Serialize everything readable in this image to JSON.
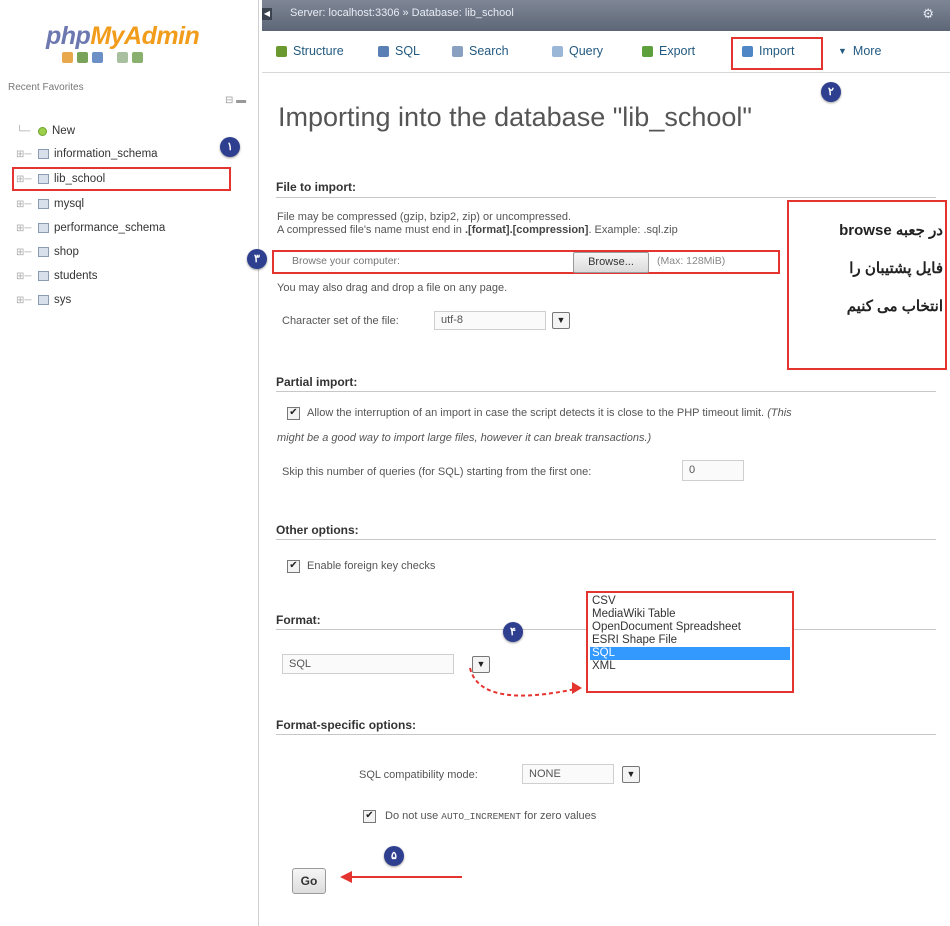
{
  "sidebar": {
    "logo_php": "php",
    "logo_myadmin": "MyAdmin",
    "recent_favorites": "Recent   Favorites",
    "databases": [
      {
        "label": "New"
      },
      {
        "label": "information_schema"
      },
      {
        "label": "lib_school"
      },
      {
        "label": "mysql"
      },
      {
        "label": "performance_schema"
      },
      {
        "label": "shop"
      },
      {
        "label": "students"
      },
      {
        "label": "sys"
      }
    ]
  },
  "topbar": {
    "breadcrumb": "Server: localhost:3306 » Database: lib_school"
  },
  "tabs": [
    {
      "label": "Structure",
      "icon": "structure-icon",
      "color": "#6a9a2f"
    },
    {
      "label": "SQL",
      "icon": "sql-icon",
      "color": "#5a7fb5"
    },
    {
      "label": "Search",
      "icon": "search-icon",
      "color": "#8aa0c0"
    },
    {
      "label": "Query",
      "icon": "query-icon",
      "color": "#9bb7d8"
    },
    {
      "label": "Export",
      "icon": "export-icon",
      "color": "#5da03c"
    },
    {
      "label": "Import",
      "icon": "import-icon",
      "color": "#4f86c6"
    },
    {
      "label": "More",
      "icon": "chevron-down-icon",
      "color": "#333333"
    }
  ],
  "page_title": "Importing into the database \"lib_school\"",
  "file_to_import": {
    "heading": "File to import:",
    "line1": "File may be compressed (gzip, bzip2, zip) or uncompressed.",
    "line2_pre": "A compressed file's name must end in ",
    "line2_bold": ".[format].[compression]",
    "line2_post": ". Example: .sql.zip",
    "browse_placeholder": "Browse your computer:",
    "browse_button": "Browse...",
    "max_size": "(Max: 128MiB)",
    "drag_drop": "You may also drag and drop a file on any page.",
    "charset_label": "Character set of the file:",
    "charset_value": "utf-8"
  },
  "callout": {
    "line1": "در جعبه browse",
    "line2": "فایل پشتیبان را",
    "line3": "انتخاب می کنیم"
  },
  "partial_import": {
    "heading": "Partial import:",
    "allow_text": "Allow the interruption of an import in case the script detects it is close to the PHP timeout limit.",
    "allow_note_1": "(This",
    "allow_note_2": "might be a good way to import large files, however it can break transactions.)",
    "skip_label": "Skip this number of queries (for SQL) starting from the first one:",
    "skip_value": "0"
  },
  "other_options": {
    "heading": "Other options:",
    "fk_checks": "Enable foreign key checks"
  },
  "format": {
    "heading": "Format:",
    "selected": "SQL",
    "options": [
      "CSV",
      "MediaWiki Table",
      "OpenDocument Spreadsheet",
      "ESRI Shape File",
      "SQL",
      "XML"
    ]
  },
  "format_specific": {
    "heading": "Format-specific options:",
    "compat_label": "SQL compatibility mode:",
    "compat_value": "NONE",
    "auto_increment_pre": "Do not use ",
    "auto_increment_code": "AUTO_INCREMENT",
    "auto_increment_post": " for zero values"
  },
  "go_button": "Go",
  "steps": [
    "۱",
    "۲",
    "۳",
    "۴",
    "۵"
  ],
  "colors": {
    "highlight": "#e3342f",
    "badge": "#2f3f8f",
    "link": "#235a81",
    "selected_option": "#3399ff"
  }
}
